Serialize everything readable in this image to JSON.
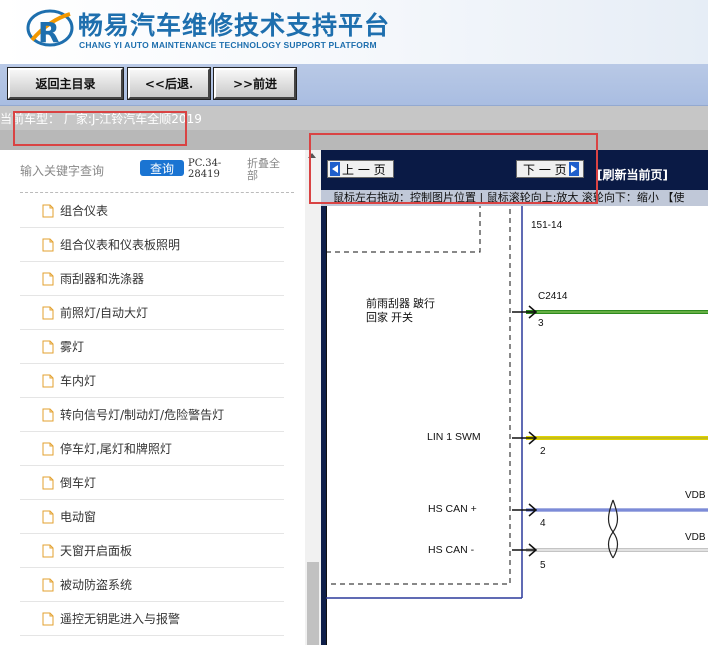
{
  "header": {
    "title": "畅易汽车维修技术支持平台",
    "subtitle": "CHANG YI AUTO MAINTENANCE TECHNOLOGY SUPPORT PLATFORM",
    "brand_color": "#1e6fae"
  },
  "nav": {
    "home_label": "返回主目录",
    "back_label": "<<后退.",
    "forward_label": ">>前进"
  },
  "model": {
    "text": "当前车型： 厂家:J-江铃汽车全顺2019"
  },
  "sidebar": {
    "search_label": "输入关键字查询",
    "search_button": "查询",
    "pc_code": "PC.34-28419",
    "collapse_all": "折叠全部",
    "items": [
      "组合仪表",
      "组合仪表和仪表板照明",
      "雨刮器和洗涤器",
      "前照灯/自动大灯",
      "雾灯",
      "车内灯",
      "转向信号灯/制动灯/危险警告灯",
      "停车灯,尾灯和牌照灯",
      "倒车灯",
      "电动窗",
      "天窗开启面板",
      "被动防盗系统",
      "遥控无钥匙进入与报警"
    ],
    "highlight_color": "#d94343"
  },
  "viewer": {
    "prev_label": "上 一 页",
    "next_label": "下 一 页",
    "refresh_label": "[刷新当前页]",
    "hint": "鼠标左右拖动：控制图片位置 | 鼠标滚轮向上:放大  滚轮向下：缩小 【使"
  },
  "diagram": {
    "page_ref": "151-14",
    "switch_label_line1": "前雨刮器 跛行",
    "switch_label_line2": "回家 开关",
    "connector": "C2414",
    "pins": [
      {
        "label": "",
        "num": "3"
      },
      {
        "label": "LIN 1 SWM",
        "num": "2"
      },
      {
        "label": "HS CAN +",
        "num": "4"
      },
      {
        "label": "HS CAN -",
        "num": "5"
      }
    ],
    "wire_label_1": "VDB",
    "wire_label_2": "VDB",
    "wire_colors": {
      "green": "#2e8b1e",
      "yellow": "#e0d400",
      "blue": "#4b5fc6",
      "white": "#ffffff"
    }
  }
}
